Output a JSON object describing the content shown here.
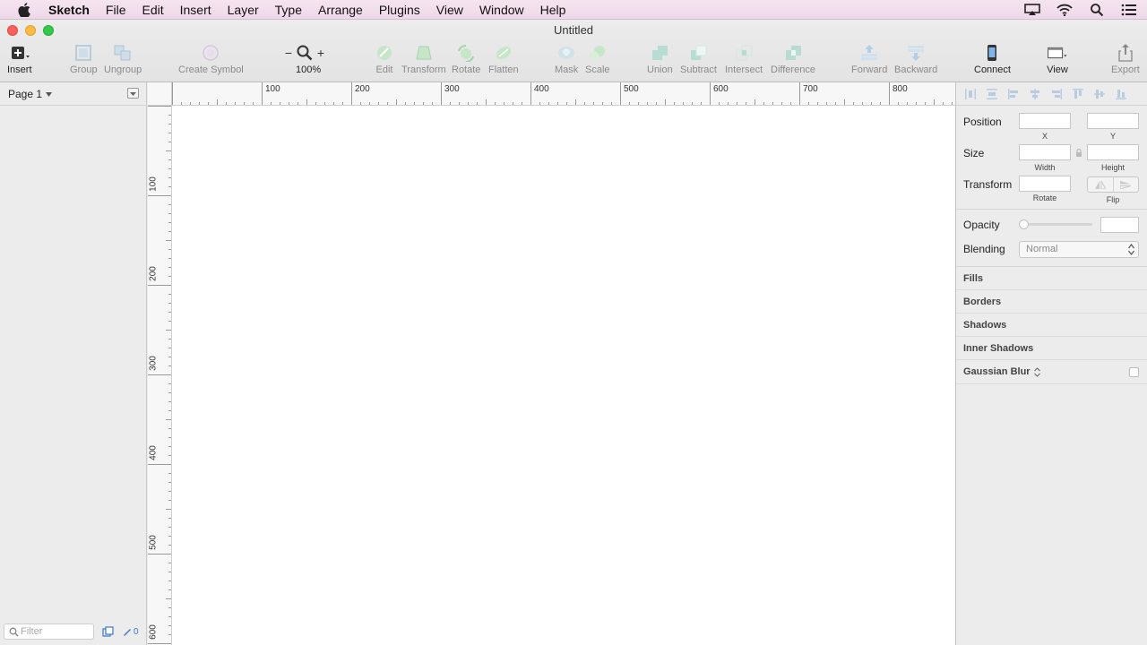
{
  "menubar": {
    "app_name": "Sketch",
    "items": [
      "File",
      "Edit",
      "Insert",
      "Layer",
      "Type",
      "Arrange",
      "Plugins",
      "View",
      "Window",
      "Help"
    ],
    "right_icons": [
      "airplay-icon",
      "wifi-icon",
      "spotlight-search-icon",
      "notification-center-icon"
    ]
  },
  "window": {
    "title": "Untitled"
  },
  "toolbar": {
    "insert": "Insert",
    "group": "Group",
    "ungroup": "Ungroup",
    "create_symbol": "Create Symbol",
    "zoom_minus": "−",
    "zoom_plus": "+",
    "zoom_level": "100%",
    "edit": "Edit",
    "transform": "Transform",
    "rotate": "Rotate",
    "flatten": "Flatten",
    "mask": "Mask",
    "scale": "Scale",
    "union": "Union",
    "subtract": "Subtract",
    "intersect": "Intersect",
    "difference": "Difference",
    "forward": "Forward",
    "backward": "Backward",
    "connect": "Connect",
    "view": "View",
    "export": "Export"
  },
  "left_panel": {
    "page_selector": "Page 1",
    "filter_placeholder": "Filter",
    "slice_count": "0"
  },
  "rulers": {
    "horizontal_labels": [
      "100",
      "200",
      "300",
      "400",
      "500",
      "600",
      "700",
      "800"
    ],
    "vertical_labels": [
      "100",
      "200",
      "300",
      "400",
      "500",
      "600"
    ]
  },
  "inspector": {
    "position_label": "Position",
    "x_label": "X",
    "y_label": "Y",
    "size_label": "Size",
    "width_label": "Width",
    "height_label": "Height",
    "transform_label": "Transform",
    "rotate_label": "Rotate",
    "flip_label": "Flip",
    "opacity_label": "Opacity",
    "blending_label": "Blending",
    "blending_value": "Normal",
    "sections": {
      "fills": "Fills",
      "borders": "Borders",
      "shadows": "Shadows",
      "inner_shadows": "Inner Shadows",
      "gaussian_blur": "Gaussian Blur"
    }
  }
}
